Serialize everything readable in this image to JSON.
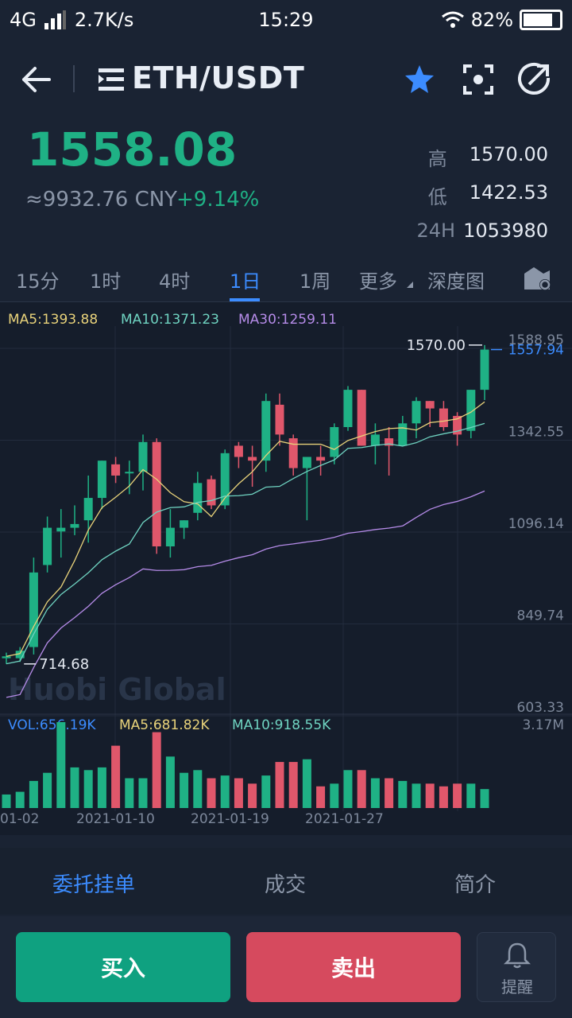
{
  "status_bar": {
    "network": "4G",
    "speed": "2.7K/s",
    "time": "15:29",
    "battery": "82%",
    "battery_level": 0.82
  },
  "header": {
    "pair": "ETH/USDT",
    "icons": [
      "back-arrow-icon",
      "menu-list-icon",
      "star-icon",
      "scan-icon",
      "share-icon"
    ]
  },
  "price": {
    "last": "1558.08",
    "cny": "≈9932.76 CNY",
    "change": "+9.14%",
    "high_label": "高",
    "high": "1570.00",
    "low_label": "低",
    "low": "1422.53",
    "vol_label": "24H",
    "vol": "1053980"
  },
  "tabs": {
    "items": [
      "15分",
      "1时",
      "4时",
      "1日",
      "1周",
      "更多",
      "深度图"
    ],
    "active": "1日"
  },
  "chart": {
    "ma_legend": [
      {
        "text": "MA5:1393.88",
        "color": "#e8d27a"
      },
      {
        "text": "MA10:1371.23",
        "color": "#6fd3c1"
      },
      {
        "text": "MA30:1259.11",
        "color": "#b58be8"
      }
    ],
    "vol_legend": [
      {
        "text": "VOL:656.19K",
        "color": "#3c8cff"
      },
      {
        "text": "MA5:681.82K",
        "color": "#e8d27a"
      },
      {
        "text": "MA10:918.55K",
        "color": "#6fd3c1"
      }
    ],
    "price_axis": [
      "1588.95",
      "1342.55",
      "1096.14",
      "849.74",
      "603.33"
    ],
    "vol_axis_max": "3.17M",
    "current_price_tag": "1557.94",
    "high_marker": "1570.00",
    "low_marker": "714.68",
    "watermark": "Huobi Global",
    "date_labels": [
      "01-02",
      "2021-01-10",
      "2021-01-19",
      "2021-01-27"
    ],
    "up_color": "#1fb185",
    "down_color": "#e0576b"
  },
  "chart_data": {
    "type": "candlestick",
    "ylim": [
      603.33,
      1588.95
    ],
    "candles": [
      {
        "o": 730,
        "h": 745,
        "l": 714.68,
        "c": 735,
        "v": 0.5
      },
      {
        "o": 730,
        "h": 760,
        "l": 720,
        "c": 750,
        "v": 0.6
      },
      {
        "o": 760,
        "h": 1000,
        "l": 740,
        "c": 960,
        "v": 1.0
      },
      {
        "o": 980,
        "h": 1110,
        "l": 960,
        "c": 1080,
        "v": 1.3
      },
      {
        "o": 1070,
        "h": 1130,
        "l": 1000,
        "c": 1080,
        "v": 3.17
      },
      {
        "o": 1080,
        "h": 1140,
        "l": 1060,
        "c": 1090,
        "v": 1.5
      },
      {
        "o": 1100,
        "h": 1220,
        "l": 1040,
        "c": 1160,
        "v": 1.4
      },
      {
        "o": 1160,
        "h": 1260,
        "l": 1130,
        "c": 1260,
        "v": 1.5
      },
      {
        "o": 1250,
        "h": 1270,
        "l": 1200,
        "c": 1220,
        "v": 2.3
      },
      {
        "o": 1230,
        "h": 1260,
        "l": 1170,
        "c": 1230,
        "v": 1.1
      },
      {
        "o": 1230,
        "h": 1330,
        "l": 1180,
        "c": 1310,
        "v": 1.1
      },
      {
        "o": 1310,
        "h": 1320,
        "l": 1010,
        "c": 1030,
        "v": 2.8
      },
      {
        "o": 1030,
        "h": 1130,
        "l": 1000,
        "c": 1080,
        "v": 1.9
      },
      {
        "o": 1080,
        "h": 1100,
        "l": 1050,
        "c": 1100,
        "v": 1.3
      },
      {
        "o": 1120,
        "h": 1230,
        "l": 1100,
        "c": 1200,
        "v": 1.4
      },
      {
        "o": 1210,
        "h": 1220,
        "l": 1130,
        "c": 1140,
        "v": 1.1
      },
      {
        "o": 1140,
        "h": 1290,
        "l": 1130,
        "c": 1280,
        "v": 1.2
      },
      {
        "o": 1300,
        "h": 1310,
        "l": 1240,
        "c": 1270,
        "v": 1.1
      },
      {
        "o": 1270,
        "h": 1300,
        "l": 1190,
        "c": 1260,
        "v": 0.9
      },
      {
        "o": 1260,
        "h": 1440,
        "l": 1230,
        "c": 1420,
        "v": 1.2
      },
      {
        "o": 1410,
        "h": 1440,
        "l": 1300,
        "c": 1330,
        "v": 1.7
      },
      {
        "o": 1320,
        "h": 1330,
        "l": 1220,
        "c": 1240,
        "v": 1.7
      },
      {
        "o": 1240,
        "h": 1270,
        "l": 1100,
        "c": 1270,
        "v": 1.8
      },
      {
        "o": 1270,
        "h": 1300,
        "l": 1220,
        "c": 1260,
        "v": 0.8
      },
      {
        "o": 1270,
        "h": 1360,
        "l": 1250,
        "c": 1350,
        "v": 0.9
      },
      {
        "o": 1350,
        "h": 1460,
        "l": 1340,
        "c": 1450,
        "v": 1.4
      },
      {
        "o": 1450,
        "h": 1450,
        "l": 1300,
        "c": 1300,
        "v": 1.4
      },
      {
        "o": 1300,
        "h": 1360,
        "l": 1250,
        "c": 1330,
        "v": 1.1
      },
      {
        "o": 1320,
        "h": 1350,
        "l": 1220,
        "c": 1300,
        "v": 1.1
      },
      {
        "o": 1300,
        "h": 1380,
        "l": 1300,
        "c": 1360,
        "v": 1.0
      },
      {
        "o": 1360,
        "h": 1430,
        "l": 1320,
        "c": 1420,
        "v": 0.9
      },
      {
        "o": 1420,
        "h": 1420,
        "l": 1350,
        "c": 1400,
        "v": 0.9
      },
      {
        "o": 1400,
        "h": 1420,
        "l": 1340,
        "c": 1350,
        "v": 0.8
      },
      {
        "o": 1380,
        "h": 1390,
        "l": 1300,
        "c": 1330,
        "v": 0.9
      },
      {
        "o": 1340,
        "h": 1450,
        "l": 1320,
        "c": 1450,
        "v": 0.9
      },
      {
        "o": 1450,
        "h": 1570,
        "l": 1422.53,
        "c": 1557.94,
        "v": 0.7
      }
    ]
  },
  "bottom_tabs": {
    "items": [
      "委托挂单",
      "成交",
      "简介"
    ],
    "active": "委托挂单"
  },
  "actions": {
    "buy": "买入",
    "sell": "卖出",
    "alert": "提醒"
  }
}
